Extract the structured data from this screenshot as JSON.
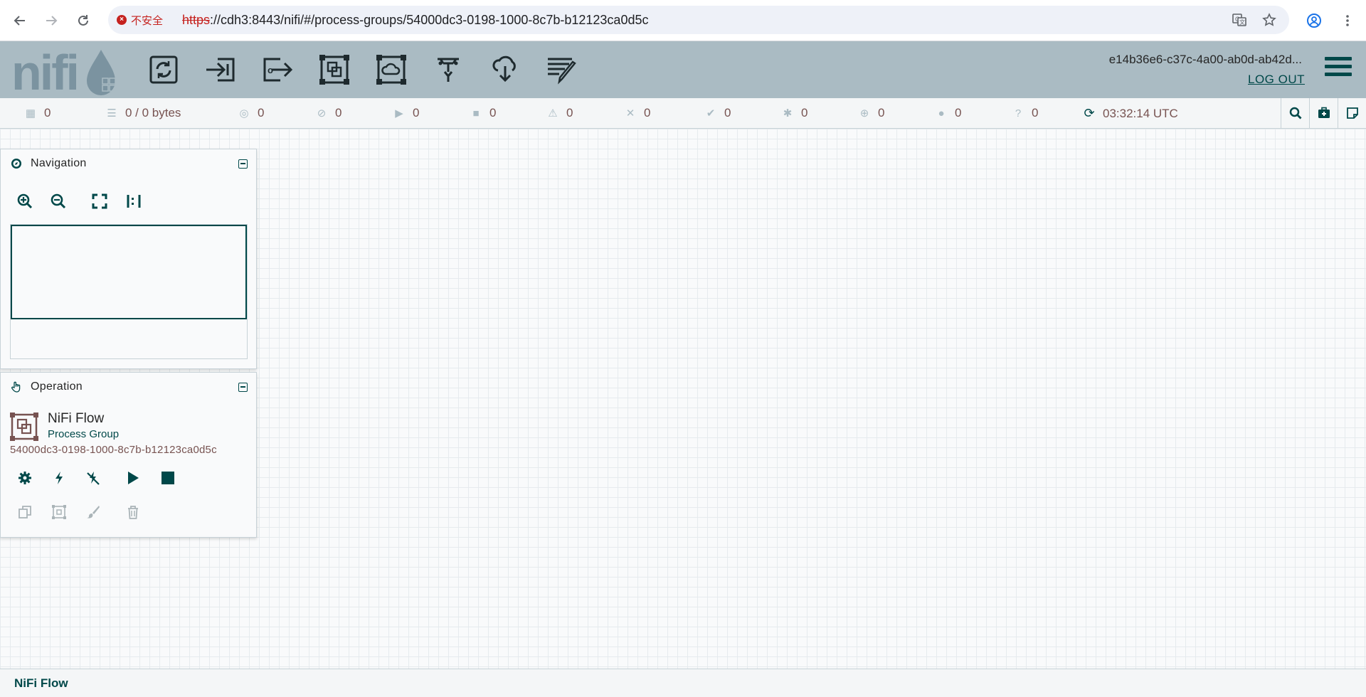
{
  "browser": {
    "insecure_label": "不安全",
    "url_protocol": "https",
    "url_rest": "://cdh3:8443/nifi/#/process-groups/54000dc3-0198-1000-8c7b-b12123ca0d5c"
  },
  "header": {
    "user_id": "e14b36e6-c37c-4a00-ab0d-ab42d...",
    "logout_label": "LOG OUT",
    "toolbar": [
      "processor-icon",
      "input-port-icon",
      "output-port-icon",
      "process-group-icon",
      "remote-process-group-icon",
      "funnel-icon",
      "template-icon",
      "label-icon"
    ]
  },
  "status": {
    "transmitting": "0",
    "queued": "0 / 0 bytes",
    "not_transmitting": "0",
    "disabled_remote": "0",
    "running": "0",
    "stopped": "0",
    "invalid": "0",
    "disabled": "0",
    "up_to_date": "0",
    "locally_modified": "0",
    "stale": "0",
    "locally_modified_stale": "0",
    "sync_failure": "0",
    "last_refreshed": "03:32:14 UTC"
  },
  "navigation": {
    "title": "Navigation"
  },
  "operation": {
    "title": "Operation",
    "component_name": "NiFi Flow",
    "component_type": "Process Group",
    "component_id": "54000dc3-0198-1000-8c7b-b12123ca0d5c"
  },
  "breadcrumb": {
    "current": "NiFi Flow"
  },
  "colors": {
    "brand": "#004849",
    "header_bg": "#aabbc3",
    "accent_text": "#775351"
  }
}
